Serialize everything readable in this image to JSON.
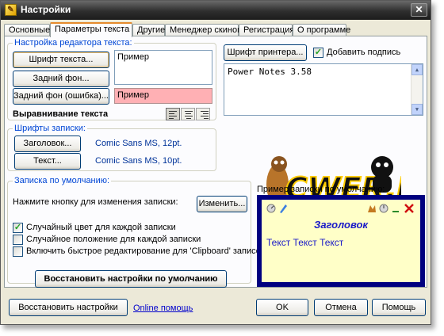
{
  "window": {
    "title": "Настройки"
  },
  "tabs": [
    "Основные",
    "Параметры текста",
    "Другие",
    "Менеджер скинов",
    "Регистрация",
    "О программе"
  ],
  "text_editor": {
    "group_title": "Настройка редактора текста:",
    "font_button": "Шрифт текста...",
    "bg_button": "Задний фон...",
    "bg_error_button": "Задний фон (ошибка)...",
    "sample_text": "Пример",
    "sample_error": "Пример",
    "align_label": "Выравнивание текста",
    "error_bg_color": "#ffb0b4"
  },
  "printer": {
    "font_button": "Шрифт принтера...",
    "add_signature_label": "Добавить подпись",
    "add_signature_checked": true,
    "signature_text": "Power Notes 3.58"
  },
  "note_fonts": {
    "group_title": "Шрифты записки:",
    "header_button": "Заголовок...",
    "header_font": "Comic Sans MS,  12pt.",
    "text_button": "Текст...",
    "text_font": "Comic Sans MS,  10pt."
  },
  "logo": {
    "text": "CWER.RU"
  },
  "defaults": {
    "group_title": "Записка по умолчанию:",
    "change_hint": "Нажмите кнопку для изменения записки:",
    "change_button": "Изменить...",
    "options": [
      {
        "label": "Случайный цвет для каждой записки",
        "checked": true
      },
      {
        "label": "Случайное положение для каждой записки",
        "checked": false
      },
      {
        "label": "Включить быстрое редактирование для 'Clipboard' записок",
        "checked": false
      }
    ],
    "restore_defaults_button": "Восстановить настройки по умолчанию"
  },
  "preview": {
    "label": "Пример записки по умолчанию:",
    "header": "Заголовок",
    "body": "Текст Текст Текст",
    "border_color": "#000080",
    "note_color": "#ffffc8"
  },
  "footer": {
    "restore_button": "Восстановить настройки",
    "online_help_link": "Online помощь",
    "ok_button": "OK",
    "cancel_button": "Отмена",
    "help_button": "Помощь"
  }
}
